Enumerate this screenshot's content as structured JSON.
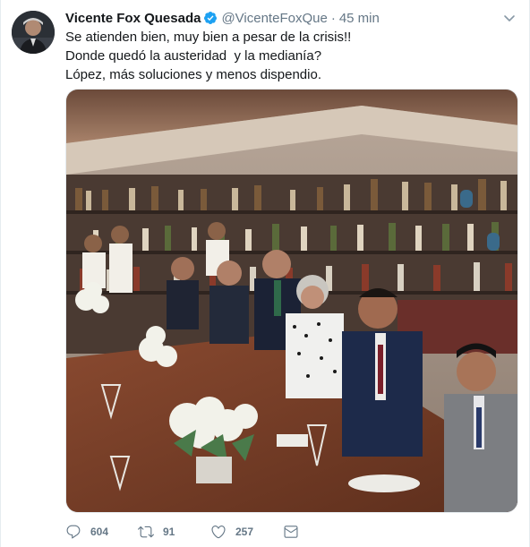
{
  "tweet": {
    "author": {
      "name": "Vicente Fox Quesada",
      "handle": "@VicenteFoxQue",
      "separator": "·",
      "time": "45 min",
      "verified": true
    },
    "text_lines": [
      "Se atienden bien, muy bien a pesar de la crisis!!",
      "Donde quedó la austeridad  y la medianía?",
      "López, más soluciones y menos dispendio."
    ],
    "media": {
      "description_icon": "photo"
    },
    "stats": {
      "replies": "604",
      "retweets": "91",
      "likes": "257"
    }
  },
  "icons": {
    "verified": "verified-badge-icon",
    "menu": "chevron-down-icon",
    "reply": "reply-icon",
    "retweet": "retweet-icon",
    "like": "heart-icon",
    "message": "envelope-icon"
  },
  "colors": {
    "text_primary": "#14171a",
    "text_secondary": "#657786",
    "verified_blue": "#1da1f2",
    "border": "#e6ecf0"
  }
}
